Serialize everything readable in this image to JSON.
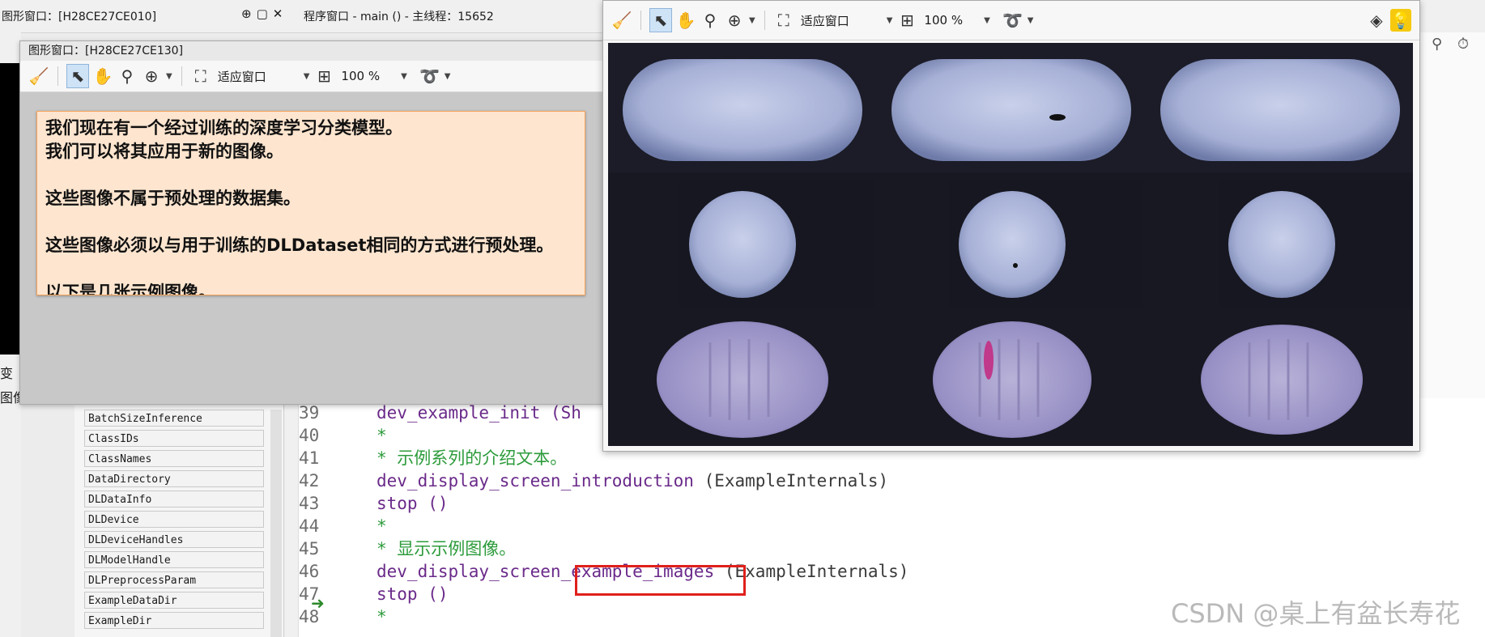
{
  "main_window": {
    "graphics_window_title": "图形窗口：[H28CE27CE010]",
    "program_window_title": "程序窗口 - main () - 主线程：15652",
    "left_strip_labels": [
      "变",
      "图像"
    ]
  },
  "graphics_window_2": {
    "title": "图形窗口：[H28CE27CE130]",
    "toolbar": {
      "fit_window": "适应窗口",
      "zoom": "100 %"
    },
    "intro_text": "我们现在有一个经过训练的深度学习分类模型。\n我们可以将其应用于新的图像。\n\n这些图像不属于预处理的数据集。\n\n这些图像必须以与用于训练的DLDataset相同的方式进行预处理。\n\n以下是几张示例图像。"
  },
  "graphics_window_3": {
    "toolbar": {
      "fit_window": "适应窗口",
      "zoom": "100 %"
    }
  },
  "variables": [
    "BatchSizeInference",
    "ClassIDs",
    "ClassNames",
    "DataDirectory",
    "DLDataInfo",
    "DLDevice",
    "DLDeviceHandles",
    "DLModelHandle",
    "DLPreprocessParam",
    "ExampleDataDir",
    "ExampleDir"
  ],
  "code": {
    "lines": [
      {
        "num": "39",
        "parts": [
          {
            "t": "dev_example_init (Sh",
            "c": "kw"
          }
        ]
      },
      {
        "num": "40",
        "parts": [
          {
            "t": "*",
            "c": "cm"
          }
        ]
      },
      {
        "num": "41",
        "parts": [
          {
            "t": "* 示例系列的介绍文本。",
            "c": "cm"
          }
        ]
      },
      {
        "num": "42",
        "parts": [
          {
            "t": "dev_display_screen_introduction ",
            "c": "kw"
          },
          {
            "t": "(ExampleInternals)",
            "c": "pl"
          }
        ]
      },
      {
        "num": "43",
        "parts": [
          {
            "t": "stop ()",
            "c": "kw"
          }
        ]
      },
      {
        "num": "44",
        "parts": [
          {
            "t": "*",
            "c": "cm"
          }
        ]
      },
      {
        "num": "45",
        "parts": [
          {
            "t": "* 显示示例图像。",
            "c": "cm"
          }
        ]
      },
      {
        "num": "46",
        "parts": [
          {
            "t": "dev_display_screen_example_images ",
            "c": "kw"
          },
          {
            "t": "(ExampleInternals)",
            "c": "pl"
          }
        ]
      },
      {
        "num": "47",
        "parts": [
          {
            "t": "stop ()",
            "c": "kw"
          }
        ]
      },
      {
        "num": "48",
        "parts": [
          {
            "t": "*",
            "c": "cm"
          }
        ]
      }
    ]
  },
  "watermark": "CSDN @桌上有盆长寿花"
}
